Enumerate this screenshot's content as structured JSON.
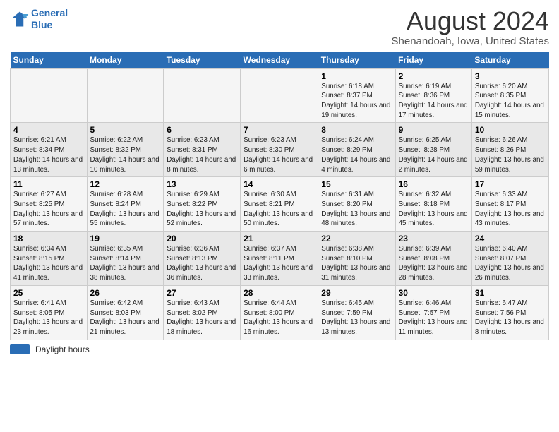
{
  "header": {
    "logo_line1": "General",
    "logo_line2": "Blue",
    "title": "August 2024",
    "subtitle": "Shenandoah, Iowa, United States"
  },
  "footer": {
    "swatch_label": "Daylight hours"
  },
  "days_of_week": [
    "Sunday",
    "Monday",
    "Tuesday",
    "Wednesday",
    "Thursday",
    "Friday",
    "Saturday"
  ],
  "weeks": [
    [
      {
        "num": "",
        "detail": ""
      },
      {
        "num": "",
        "detail": ""
      },
      {
        "num": "",
        "detail": ""
      },
      {
        "num": "",
        "detail": ""
      },
      {
        "num": "1",
        "detail": "Sunrise: 6:18 AM\nSunset: 8:37 PM\nDaylight: 14 hours and 19 minutes."
      },
      {
        "num": "2",
        "detail": "Sunrise: 6:19 AM\nSunset: 8:36 PM\nDaylight: 14 hours and 17 minutes."
      },
      {
        "num": "3",
        "detail": "Sunrise: 6:20 AM\nSunset: 8:35 PM\nDaylight: 14 hours and 15 minutes."
      }
    ],
    [
      {
        "num": "4",
        "detail": "Sunrise: 6:21 AM\nSunset: 8:34 PM\nDaylight: 14 hours and 13 minutes."
      },
      {
        "num": "5",
        "detail": "Sunrise: 6:22 AM\nSunset: 8:32 PM\nDaylight: 14 hours and 10 minutes."
      },
      {
        "num": "6",
        "detail": "Sunrise: 6:23 AM\nSunset: 8:31 PM\nDaylight: 14 hours and 8 minutes."
      },
      {
        "num": "7",
        "detail": "Sunrise: 6:23 AM\nSunset: 8:30 PM\nDaylight: 14 hours and 6 minutes."
      },
      {
        "num": "8",
        "detail": "Sunrise: 6:24 AM\nSunset: 8:29 PM\nDaylight: 14 hours and 4 minutes."
      },
      {
        "num": "9",
        "detail": "Sunrise: 6:25 AM\nSunset: 8:28 PM\nDaylight: 14 hours and 2 minutes."
      },
      {
        "num": "10",
        "detail": "Sunrise: 6:26 AM\nSunset: 8:26 PM\nDaylight: 13 hours and 59 minutes."
      }
    ],
    [
      {
        "num": "11",
        "detail": "Sunrise: 6:27 AM\nSunset: 8:25 PM\nDaylight: 13 hours and 57 minutes."
      },
      {
        "num": "12",
        "detail": "Sunrise: 6:28 AM\nSunset: 8:24 PM\nDaylight: 13 hours and 55 minutes."
      },
      {
        "num": "13",
        "detail": "Sunrise: 6:29 AM\nSunset: 8:22 PM\nDaylight: 13 hours and 52 minutes."
      },
      {
        "num": "14",
        "detail": "Sunrise: 6:30 AM\nSunset: 8:21 PM\nDaylight: 13 hours and 50 minutes."
      },
      {
        "num": "15",
        "detail": "Sunrise: 6:31 AM\nSunset: 8:20 PM\nDaylight: 13 hours and 48 minutes."
      },
      {
        "num": "16",
        "detail": "Sunrise: 6:32 AM\nSunset: 8:18 PM\nDaylight: 13 hours and 45 minutes."
      },
      {
        "num": "17",
        "detail": "Sunrise: 6:33 AM\nSunset: 8:17 PM\nDaylight: 13 hours and 43 minutes."
      }
    ],
    [
      {
        "num": "18",
        "detail": "Sunrise: 6:34 AM\nSunset: 8:15 PM\nDaylight: 13 hours and 41 minutes."
      },
      {
        "num": "19",
        "detail": "Sunrise: 6:35 AM\nSunset: 8:14 PM\nDaylight: 13 hours and 38 minutes."
      },
      {
        "num": "20",
        "detail": "Sunrise: 6:36 AM\nSunset: 8:13 PM\nDaylight: 13 hours and 36 minutes."
      },
      {
        "num": "21",
        "detail": "Sunrise: 6:37 AM\nSunset: 8:11 PM\nDaylight: 13 hours and 33 minutes."
      },
      {
        "num": "22",
        "detail": "Sunrise: 6:38 AM\nSunset: 8:10 PM\nDaylight: 13 hours and 31 minutes."
      },
      {
        "num": "23",
        "detail": "Sunrise: 6:39 AM\nSunset: 8:08 PM\nDaylight: 13 hours and 28 minutes."
      },
      {
        "num": "24",
        "detail": "Sunrise: 6:40 AM\nSunset: 8:07 PM\nDaylight: 13 hours and 26 minutes."
      }
    ],
    [
      {
        "num": "25",
        "detail": "Sunrise: 6:41 AM\nSunset: 8:05 PM\nDaylight: 13 hours and 23 minutes."
      },
      {
        "num": "26",
        "detail": "Sunrise: 6:42 AM\nSunset: 8:03 PM\nDaylight: 13 hours and 21 minutes."
      },
      {
        "num": "27",
        "detail": "Sunrise: 6:43 AM\nSunset: 8:02 PM\nDaylight: 13 hours and 18 minutes."
      },
      {
        "num": "28",
        "detail": "Sunrise: 6:44 AM\nSunset: 8:00 PM\nDaylight: 13 hours and 16 minutes."
      },
      {
        "num": "29",
        "detail": "Sunrise: 6:45 AM\nSunset: 7:59 PM\nDaylight: 13 hours and 13 minutes."
      },
      {
        "num": "30",
        "detail": "Sunrise: 6:46 AM\nSunset: 7:57 PM\nDaylight: 13 hours and 11 minutes."
      },
      {
        "num": "31",
        "detail": "Sunrise: 6:47 AM\nSunset: 7:56 PM\nDaylight: 13 hours and 8 minutes."
      }
    ]
  ]
}
